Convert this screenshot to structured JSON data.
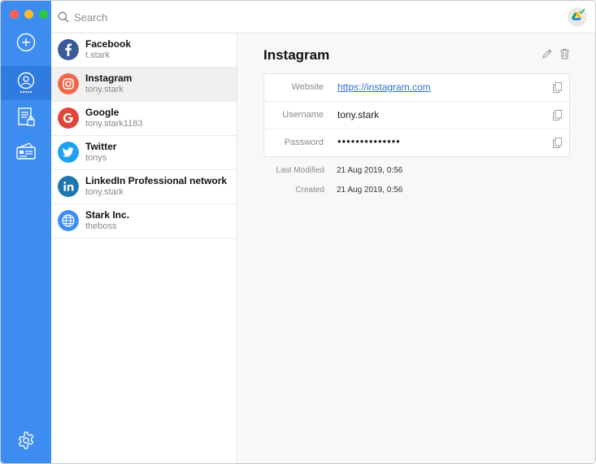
{
  "window": {
    "traffic_lights": [
      "close",
      "minimize",
      "maximize"
    ]
  },
  "rail": {
    "items": [
      {
        "icon": "add-circle-icon",
        "active": false
      },
      {
        "icon": "accounts-icon",
        "active": true
      },
      {
        "icon": "secure-notes-icon",
        "active": false
      },
      {
        "icon": "cards-icon",
        "active": false
      }
    ],
    "bottom_icon": "gear-icon",
    "accent": "#3d8df0"
  },
  "search": {
    "placeholder": "Search",
    "value": ""
  },
  "sync_icon": "google-drive-sync-check-icon",
  "list": {
    "items": [
      {
        "title": "Facebook",
        "subtitle": "t.stark",
        "icon": "facebook-icon",
        "color": "#3b5998"
      },
      {
        "title": "Instagram",
        "subtitle": "tony.stark",
        "icon": "instagram-icon",
        "color": "#f0674b"
      },
      {
        "title": "Google",
        "subtitle": "tony.stark1183",
        "icon": "google-icon",
        "color": "#e0463a"
      },
      {
        "title": "Twitter",
        "subtitle": "tonys",
        "icon": "twitter-icon",
        "color": "#1da1f2"
      },
      {
        "title": "LinkedIn Professional network",
        "subtitle": "tony.stark",
        "icon": "linkedin-icon",
        "color": "#1c77b0"
      },
      {
        "title": "Stark Inc.",
        "subtitle": "theboss",
        "icon": "globe-icon",
        "color": "#3e8df0"
      }
    ],
    "selected_index": 1
  },
  "detail": {
    "title": "Instagram",
    "fields": {
      "website_label": "Website",
      "website_value": "https://instagram.com",
      "username_label": "Username",
      "username_value": "tony.stark",
      "password_label": "Password",
      "password_value": "••••••••••••••"
    },
    "meta": {
      "modified_label": "Last Modified",
      "modified_value": "21 Aug 2019, 0:56",
      "created_label": "Created",
      "created_value": "21 Aug 2019, 0:56"
    }
  }
}
